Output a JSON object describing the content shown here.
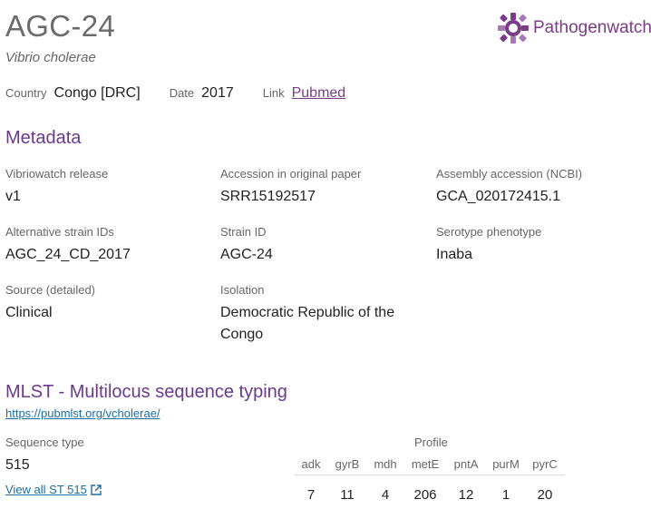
{
  "header": {
    "title": "AGC-24",
    "species": "Vibrio cholerae",
    "logo_text": "Pathogenwatch"
  },
  "summary": {
    "country_label": "Country",
    "country_value": "Congo [DRC]",
    "date_label": "Date",
    "date_value": "2017",
    "link_label": "Link",
    "link_value": "Pubmed"
  },
  "metadata": {
    "heading": "Metadata",
    "fields": [
      {
        "label": "Vibriowatch release",
        "value": "v1"
      },
      {
        "label": "Accession in original paper",
        "value": "SRR15192517"
      },
      {
        "label": "Assembly accession (NCBI)",
        "value": "GCA_020172415.1"
      },
      {
        "label": "Alternative strain IDs",
        "value": "AGC_24_CD_2017"
      },
      {
        "label": "Strain ID",
        "value": "AGC-24"
      },
      {
        "label": "Serotype phenotype",
        "value": "Inaba"
      },
      {
        "label": "Source (detailed)",
        "value": "Clinical"
      },
      {
        "label": "Isolation",
        "value": "Democratic Republic of the Congo"
      }
    ]
  },
  "mlst": {
    "heading": "MLST - Multilocus sequence typing",
    "url": "https://pubmlst.org/vcholerae/",
    "sequence_type_label": "Sequence type",
    "sequence_type_value": "515",
    "view_all_label": "View all ST 515",
    "profile_label": "Profile",
    "profile_headers": [
      "adk",
      "gyrB",
      "mdh",
      "metE",
      "pntA",
      "purM",
      "pyrC"
    ],
    "profile_values": [
      "7",
      "11",
      "4",
      "206",
      "12",
      "1",
      "20"
    ]
  },
  "colors": {
    "accent": "#6a3a8c",
    "link": "#1a6ea0"
  }
}
